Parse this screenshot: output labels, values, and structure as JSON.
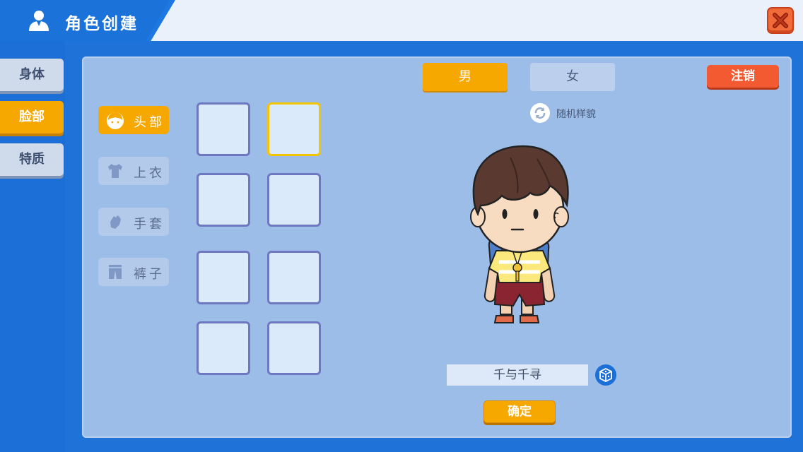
{
  "header": {
    "title": "角色创建",
    "icons": {
      "title": "user-icon",
      "close": "close-icon"
    }
  },
  "sidebar": {
    "tabs": [
      {
        "label": "身体",
        "active": false
      },
      {
        "label": "脸部",
        "active": true
      },
      {
        "label": "特质",
        "active": false
      }
    ]
  },
  "categories": [
    {
      "label": "头部",
      "icon": "hair-icon",
      "active": true
    },
    {
      "label": "上衣",
      "icon": "shirt-icon",
      "active": false
    },
    {
      "label": "手套",
      "icon": "glove-icon",
      "active": false
    },
    {
      "label": "裤子",
      "icon": "pants-icon",
      "active": false
    }
  ],
  "gender": {
    "male": "男",
    "female": "女",
    "selected": "男"
  },
  "logout_label": "注销",
  "random_label": "随机样貌",
  "name_value": "千与千寻",
  "confirm_label": "确定",
  "colors": {
    "accent": "#f7a800",
    "panel": "#9cbde8",
    "logout": "#f45a32",
    "header_blue": "#1b72d8"
  }
}
